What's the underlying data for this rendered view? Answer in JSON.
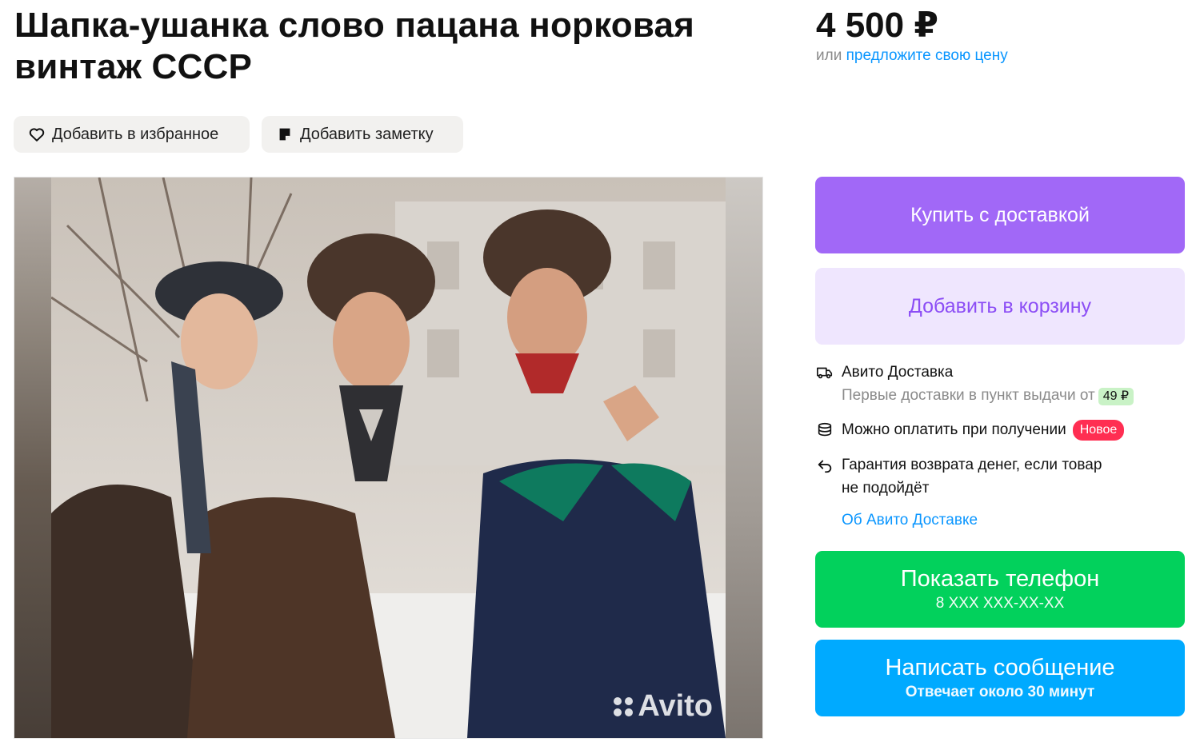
{
  "listing": {
    "title": "Шапка-ушанка слово пацана норковая винтаж СССР",
    "price": "4 500 ₽",
    "offer_prefix": "или",
    "offer_link": "предложите свою цену"
  },
  "actions": {
    "favorite_label": "Добавить в избранное",
    "note_label": "Добавить заметку"
  },
  "gallery": {
    "watermark": "Avito"
  },
  "buy": {
    "buy_label": "Купить с доставкой",
    "cart_label": "Добавить в корзину"
  },
  "delivery": {
    "title": "Авито Доставка",
    "subtitle": "Первые доставки в пункт выдачи от",
    "price_badge": "49 ₽",
    "pay_on_receipt": "Можно оплатить при получении",
    "new_badge": "Новое",
    "guarantee_line1": "Гарантия возврата денег, если товар",
    "guarantee_line2": "не подойдёт",
    "about_link": "Об Авито Доставке"
  },
  "contact": {
    "phone_label": "Показать телефон",
    "phone_masked": "8 XXX XXX-XX-XX",
    "message_label": "Написать сообщение",
    "message_sub": "Отвечает около 30 минут"
  },
  "colors": {
    "purple": "#a168f7",
    "purple_light": "#efe6fe",
    "green": "#02d15c",
    "blue": "#00aaff",
    "link": "#0a96ff",
    "new_badge": "#ff2e52"
  },
  "icons": [
    "heart-icon",
    "note-icon",
    "truck-icon",
    "coins-icon",
    "return-arrow-icon",
    "avito-logo-icon"
  ]
}
